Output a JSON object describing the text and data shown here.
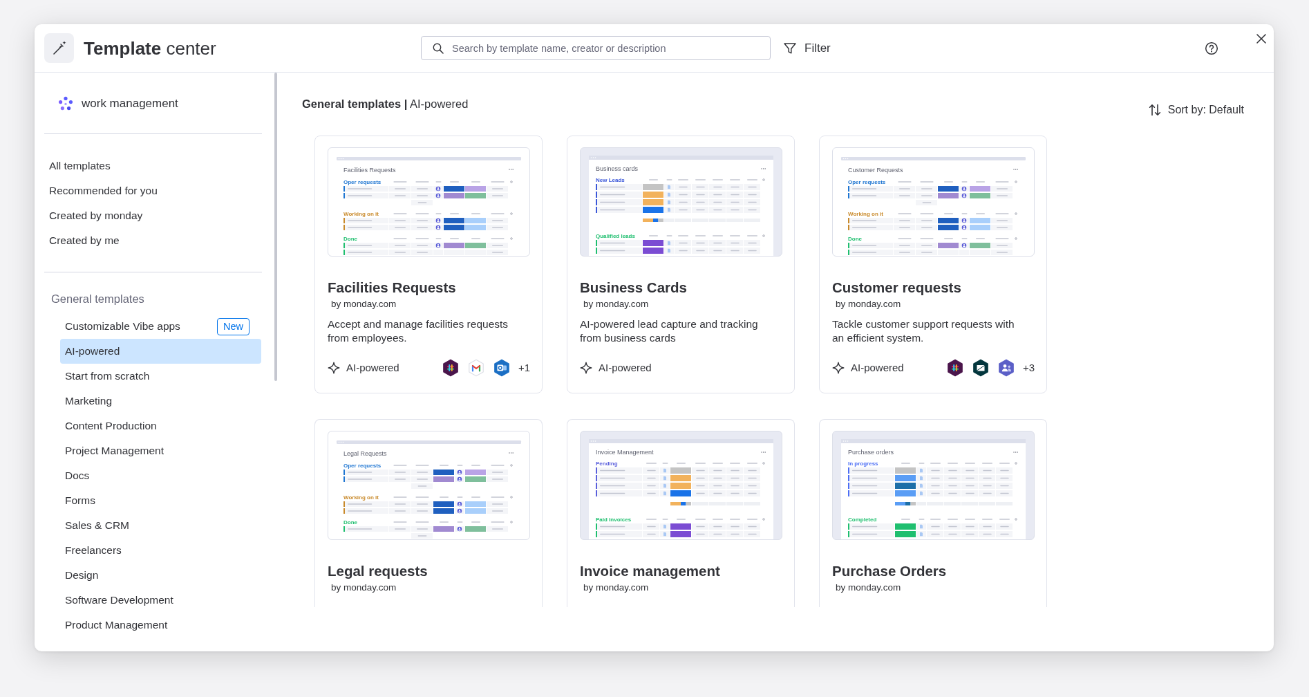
{
  "header": {
    "title": "**Template** center",
    "search": {
      "placeholder": "Search by template name, creator or description"
    },
    "filter": "Filter"
  },
  "sidebar": {
    "product": "work management",
    "items": [
      {
        "label": "All templates",
        "selected": false
      },
      {
        "label": "Recommended for you",
        "selected": false
      },
      {
        "label": "Created by monday",
        "selected": false
      },
      {
        "label": "Created by me",
        "selected": false
      }
    ],
    "section": {
      "title": "General templates",
      "items": [
        {
          "label": "Customizable Vibe apps",
          "badge": "New",
          "selected": false
        },
        {
          "label": "AI-powered",
          "selected": true
        },
        {
          "label": "Start from scratch",
          "selected": false
        },
        {
          "label": "Marketing",
          "selected": false
        },
        {
          "label": "Content Production",
          "selected": false
        },
        {
          "label": "Project Management",
          "selected": false
        },
        {
          "label": "Docs",
          "selected": false
        },
        {
          "label": "Forms",
          "selected": false
        },
        {
          "label": "Sales & CRM",
          "selected": false
        },
        {
          "label": "Freelancers",
          "selected": false
        },
        {
          "label": "Design",
          "selected": false
        },
        {
          "label": "Software Development",
          "selected": false
        },
        {
          "label": "Product Management",
          "selected": false
        }
      ]
    }
  },
  "content": {
    "heading": "**General templates |** AI-powered",
    "sort": "Sort by: Default",
    "cards": [
      {
        "title": "Facilities Requests",
        "author": "by monday.com",
        "description": "Accept and manage facilities requests from employees.",
        "tag": "AI-powered",
        "integrations": [
          {
            "kind": "hash"
          },
          {
            "kind": "envelope"
          },
          {
            "kind": "mail-tile"
          }
        ],
        "more": "+1",
        "preview": {
          "kind": "plain",
          "title": "Facilities Requests",
          "columns": [
            {
              "kind": "text"
            },
            {
              "kind": "text"
            },
            {
              "kind": "person"
            },
            {
              "kind": "status"
            },
            {
              "kind": "status"
            },
            {
              "kind": "text"
            }
          ],
          "groups": [
            {
              "label": "Oper requests",
              "color": "#1f76d2",
              "summary": true,
              "rows": [
                {
                  "kind": "filled",
                  "cells": [
                    {
                      "color": "#1f5fbf"
                    },
                    {
                      "color": "#b9a3e6"
                    }
                  ]
                },
                {
                  "kind": "filled",
                  "cells": [
                    {
                      "color": "#a18ad1"
                    },
                    {
                      "color": "#7fbf9c"
                    }
                  ]
                }
              ]
            },
            {
              "label": "Working on it",
              "color": "#c98a2b",
              "summary": false,
              "rows": [
                {
                  "kind": "filled",
                  "cells": [
                    {
                      "color": "#1f5fbf"
                    },
                    {
                      "color": "#a9cffb"
                    }
                  ]
                },
                {
                  "kind": "filled",
                  "cells": [
                    {
                      "color": "#1f5fbf"
                    },
                    {
                      "color": "#a9cffb"
                    }
                  ]
                }
              ]
            },
            {
              "label": "Done",
              "color": "#1fbf6f",
              "summary": false,
              "rows": [
                {
                  "kind": "filled",
                  "cells": [
                    {
                      "color": "#a18ad1"
                    },
                    {
                      "color": "#7fbf9c"
                    }
                  ]
                },
                {
                  "kind": "blank"
                }
              ]
            }
          ]
        }
      },
      {
        "title": "Business Cards",
        "author": "by monday.com",
        "description": "AI-powered lead capture and tracking from business cards",
        "tag": "AI-powered",
        "preview": {
          "kind": "framed",
          "title": "Business cards",
          "columns": [
            {
              "kind": "status"
            },
            {
              "kind": "file"
            },
            {
              "kind": "text"
            },
            {
              "kind": "text"
            },
            {
              "kind": "text"
            },
            {
              "kind": "text"
            },
            {
              "kind": "text"
            }
          ],
          "groups": [
            {
              "label": "New Leads",
              "color": "#3b57d9",
              "summary": true,
              "rows": [
                {
                  "kind": "filled",
                  "cells": [
                    {
                      "color": "#c4c4c4"
                    }
                  ]
                },
                {
                  "kind": "filled",
                  "cells": [
                    {
                      "color": "#f2b25c"
                    }
                  ]
                },
                {
                  "kind": "filled",
                  "cells": [
                    {
                      "color": "#f2b25c"
                    }
                  ]
                },
                {
                  "kind": "filled",
                  "cells": [
                    {
                      "color": "#1a73e8"
                    }
                  ]
                }
              ]
            },
            {
              "label": "Qualified leads",
              "color": "#1fbf6f",
              "summary": false,
              "rows": [
                {
                  "kind": "filled",
                  "cells": [
                    {
                      "color": "#7b4cd3"
                    }
                  ]
                },
                {
                  "kind": "filled",
                  "cells": [
                    {
                      "color": "#7b4cd3"
                    }
                  ]
                }
              ]
            }
          ]
        }
      },
      {
        "title": "Customer requests",
        "author": "by monday.com",
        "description": "Tackle customer support requests with an efficient system.",
        "tag": "AI-powered",
        "integrations": [
          {
            "kind": "hash"
          },
          {
            "kind": "triangles"
          },
          {
            "kind": "people"
          }
        ],
        "more": "+3",
        "preview": {
          "kind": "plain",
          "title": "Customer Requests",
          "columns": [
            {
              "kind": "text"
            },
            {
              "kind": "text"
            },
            {
              "kind": "status"
            },
            {
              "kind": "person"
            },
            {
              "kind": "status"
            },
            {
              "kind": "text"
            }
          ],
          "groups": [
            {
              "label": "Oper requests",
              "color": "#1f76d2",
              "summary": true,
              "rows": [
                {
                  "kind": "filled",
                  "cells": [
                    {
                      "color": "#1f5fbf"
                    },
                    {
                      "color": "#b9a3e6"
                    }
                  ]
                },
                {
                  "kind": "filled",
                  "cells": [
                    {
                      "color": "#a18ad1"
                    },
                    {
                      "color": "#7fbf9c"
                    }
                  ]
                }
              ]
            },
            {
              "label": "Working on it",
              "color": "#c98a2b",
              "summary": false,
              "rows": [
                {
                  "kind": "filled",
                  "cells": [
                    {
                      "color": "#1f5fbf"
                    },
                    {
                      "color": "#a9cffb"
                    }
                  ]
                },
                {
                  "kind": "filled",
                  "cells": [
                    {
                      "color": "#1f5fbf"
                    },
                    {
                      "color": "#a9cffb"
                    }
                  ]
                }
              ]
            },
            {
              "label": "Done",
              "color": "#1fbf6f",
              "summary": false,
              "rows": [
                {
                  "kind": "filled",
                  "cells": [
                    {
                      "color": "#a18ad1"
                    },
                    {
                      "color": "#7fbf9c"
                    }
                  ]
                },
                {
                  "kind": "blank"
                }
              ]
            }
          ]
        }
      },
      {
        "title": "Legal requests",
        "author": "by monday.com",
        "preview": {
          "kind": "plain",
          "title": "Legal Requests",
          "columns": [
            {
              "kind": "text"
            },
            {
              "kind": "text"
            },
            {
              "kind": "status"
            },
            {
              "kind": "person"
            },
            {
              "kind": "status"
            },
            {
              "kind": "text"
            }
          ],
          "groups": [
            {
              "label": "Oper requests",
              "color": "#1f76d2",
              "summary": true,
              "rows": [
                {
                  "kind": "filled",
                  "cells": [
                    {
                      "color": "#1f5fbf"
                    },
                    {
                      "color": "#b9a3e6"
                    }
                  ]
                },
                {
                  "kind": "filled",
                  "cells": [
                    {
                      "color": "#a18ad1"
                    },
                    {
                      "color": "#7fbf9c"
                    }
                  ]
                }
              ]
            },
            {
              "label": "Working on it",
              "color": "#c98a2b",
              "summary": false,
              "rows": [
                {
                  "kind": "filled",
                  "cells": [
                    {
                      "color": "#1f5fbf"
                    },
                    {
                      "color": "#a9cffb"
                    }
                  ]
                },
                {
                  "kind": "filled",
                  "cells": [
                    {
                      "color": "#1f5fbf"
                    },
                    {
                      "color": "#a9cffb"
                    }
                  ]
                }
              ]
            },
            {
              "label": "Done",
              "color": "#1fbf6f",
              "summary": true,
              "rows": [
                {
                  "kind": "filled",
                  "cells": [
                    {
                      "color": "#a18ad1"
                    },
                    {
                      "color": "#7fbf9c"
                    }
                  ]
                }
              ]
            }
          ]
        }
      },
      {
        "title": "Invoice management",
        "author": "by monday.com",
        "preview": {
          "kind": "framed",
          "title": "Invoice Management",
          "columns": [
            {
              "kind": "text"
            },
            {
              "kind": "file"
            },
            {
              "kind": "status"
            },
            {
              "kind": "text"
            },
            {
              "kind": "text"
            },
            {
              "kind": "text"
            },
            {
              "kind": "text"
            }
          ],
          "groups": [
            {
              "label": "Pending",
              "color": "#5a5fdc",
              "summary": true,
              "rows": [
                {
                  "kind": "filled",
                  "cells": [
                    {
                      "color": "#c4c4c4"
                    }
                  ]
                },
                {
                  "kind": "filled",
                  "cells": [
                    {
                      "color": "#f2b25c"
                    }
                  ]
                },
                {
                  "kind": "filled",
                  "cells": [
                    {
                      "color": "#f2b25c"
                    }
                  ]
                },
                {
                  "kind": "filled",
                  "cells": [
                    {
                      "color": "#1a73e8"
                    }
                  ]
                }
              ]
            },
            {
              "label": "Paid invoices",
              "color": "#1fbf6f",
              "summary": false,
              "rows": [
                {
                  "kind": "filled",
                  "cells": [
                    {
                      "color": "#7b4cd3"
                    }
                  ]
                },
                {
                  "kind": "filled",
                  "cells": [
                    {
                      "color": "#7b4cd3"
                    }
                  ]
                }
              ]
            }
          ]
        }
      },
      {
        "title": "Purchase Orders",
        "author": "by monday.com",
        "preview": {
          "kind": "framed",
          "title": "Purchase orders",
          "columns": [
            {
              "kind": "status"
            },
            {
              "kind": "file"
            },
            {
              "kind": "text"
            },
            {
              "kind": "text"
            },
            {
              "kind": "text"
            },
            {
              "kind": "text"
            },
            {
              "kind": "text"
            }
          ],
          "groups": [
            {
              "label": "In progress",
              "color": "#4c6ef5",
              "summary": true,
              "rows": [
                {
                  "kind": "filled",
                  "cells": [
                    {
                      "color": "#c4c4c4"
                    }
                  ]
                },
                {
                  "kind": "filled",
                  "cells": [
                    {
                      "color": "#5a9df5"
                    }
                  ]
                },
                {
                  "kind": "filled",
                  "cells": [
                    {
                      "color": "#1d6fa8"
                    }
                  ]
                },
                {
                  "kind": "filled",
                  "cells": [
                    {
                      "color": "#5a9df5"
                    }
                  ]
                }
              ]
            },
            {
              "label": "Completed",
              "color": "#1fbf6f",
              "summary": false,
              "rows": [
                {
                  "kind": "filled",
                  "cells": [
                    {
                      "color": "#1fbf6f"
                    }
                  ]
                },
                {
                  "kind": "filled",
                  "cells": [
                    {
                      "color": "#1fbf6f"
                    }
                  ]
                }
              ]
            }
          ]
        }
      }
    ]
  }
}
